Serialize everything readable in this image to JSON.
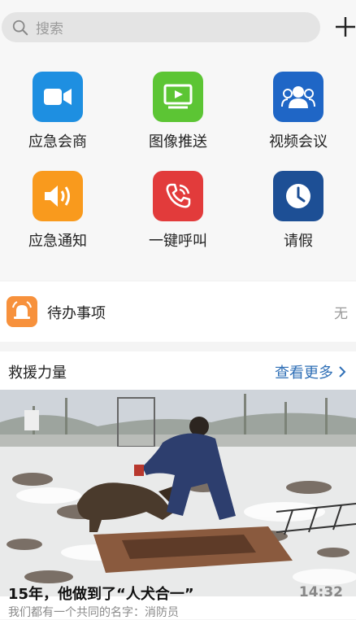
{
  "search": {
    "placeholder": "搜索"
  },
  "features": [
    {
      "label": "应急会商",
      "icon": "video-camera-icon",
      "color": "#1e8fe1"
    },
    {
      "label": "图像推送",
      "icon": "play-screen-icon",
      "color": "#5cc534"
    },
    {
      "label": "视频会议",
      "icon": "group-users-icon",
      "color": "#1f66c6"
    },
    {
      "label": "应急通知",
      "icon": "speaker-icon",
      "color": "#f99a1d"
    },
    {
      "label": "一键呼叫",
      "icon": "phone-call-icon",
      "color": "#e23b3b"
    },
    {
      "label": "请假",
      "icon": "clock-icon",
      "color": "#1d4f95"
    }
  ],
  "todo": {
    "title": "待办事项",
    "state": "无",
    "color": "#f7913c"
  },
  "rescue": {
    "heading": "救援力量",
    "more_label": "查看更多",
    "article": {
      "title": "15年，他做到了“人犬合一”",
      "time": "14:32",
      "subtitle": "我们都有一个共同的名字：消防员"
    }
  }
}
